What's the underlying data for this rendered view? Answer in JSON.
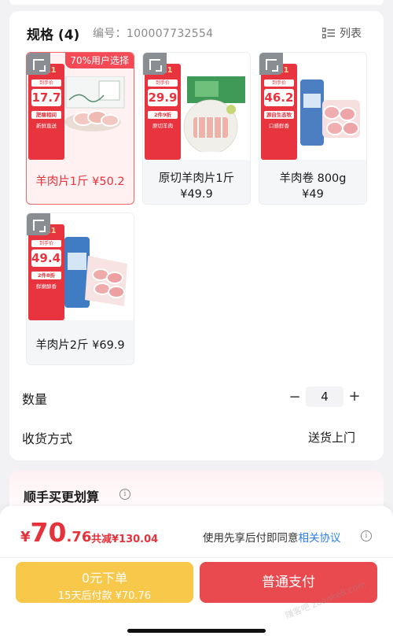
{
  "spec": {
    "title": "规格 (4)",
    "code_label": "编号：100007732554",
    "list_toggle_label": "列表"
  },
  "products": [
    {
      "name": "羊肉片1斤 ¥50.2",
      "price": "",
      "badge": "70%用户选择",
      "poster_price": "17.7",
      "poster_tag": "到手价",
      "poster_line1": "肥瘦相间",
      "poster_line2": "新鲜直送"
    },
    {
      "name": "原切羊肉片1斤",
      "price": "¥49.9",
      "poster_price": "29.9",
      "poster_tag": "到手价",
      "poster_line1": "2件9折",
      "poster_line2": "原切羊肉"
    },
    {
      "name": "羊肉卷 800g",
      "price": "¥49",
      "poster_price": "46.2",
      "poster_tag": "到手价",
      "poster_line1": "源自生态牧场",
      "poster_line2": "口感鲜香"
    },
    {
      "name": "羊肉片2斤 ¥69.9",
      "price": "",
      "poster_price": "49.41",
      "poster_tag": "到手价",
      "poster_line1": "2件8折",
      "poster_line2": "鲜嫩醇香"
    }
  ],
  "quantity": {
    "label": "数量",
    "value": "4",
    "minus": "−",
    "plus": "+"
  },
  "delivery": {
    "label": "收货方式",
    "value": "送货上门"
  },
  "upsell": {
    "title": "顺手买更划算"
  },
  "footer": {
    "currency": "¥",
    "price_int": "70",
    "price_dec": ".76",
    "discount": "共减¥130.04",
    "agreement_text": "使用先享后付即同意",
    "agreement_link": "相关协议",
    "later_line1": "0元下单",
    "later_line2": "15天后付款 ¥70.76",
    "pay_label": "普通支付"
  },
  "watermark": "赚客吧 zuanke8.com",
  "colors": {
    "accent_red": "#e5323b",
    "pay_button": "#e84a4f",
    "later_button": "#f7c84a",
    "link_blue": "#2d7ee8"
  }
}
